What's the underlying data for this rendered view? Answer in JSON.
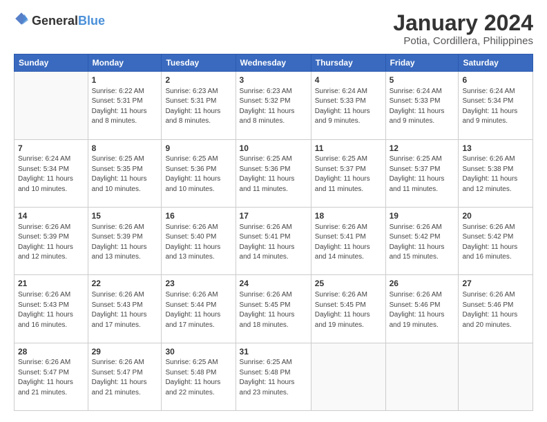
{
  "header": {
    "logo_general": "General",
    "logo_blue": "Blue",
    "month": "January 2024",
    "location": "Potia, Cordillera, Philippines"
  },
  "weekdays": [
    "Sunday",
    "Monday",
    "Tuesday",
    "Wednesday",
    "Thursday",
    "Friday",
    "Saturday"
  ],
  "rows": [
    [
      {
        "day": "",
        "sunrise": "",
        "sunset": "",
        "daylight": ""
      },
      {
        "day": "1",
        "sunrise": "Sunrise: 6:22 AM",
        "sunset": "Sunset: 5:31 PM",
        "daylight": "Daylight: 11 hours and 8 minutes."
      },
      {
        "day": "2",
        "sunrise": "Sunrise: 6:23 AM",
        "sunset": "Sunset: 5:31 PM",
        "daylight": "Daylight: 11 hours and 8 minutes."
      },
      {
        "day": "3",
        "sunrise": "Sunrise: 6:23 AM",
        "sunset": "Sunset: 5:32 PM",
        "daylight": "Daylight: 11 hours and 8 minutes."
      },
      {
        "day": "4",
        "sunrise": "Sunrise: 6:24 AM",
        "sunset": "Sunset: 5:33 PM",
        "daylight": "Daylight: 11 hours and 9 minutes."
      },
      {
        "day": "5",
        "sunrise": "Sunrise: 6:24 AM",
        "sunset": "Sunset: 5:33 PM",
        "daylight": "Daylight: 11 hours and 9 minutes."
      },
      {
        "day": "6",
        "sunrise": "Sunrise: 6:24 AM",
        "sunset": "Sunset: 5:34 PM",
        "daylight": "Daylight: 11 hours and 9 minutes."
      }
    ],
    [
      {
        "day": "7",
        "sunrise": "Sunrise: 6:24 AM",
        "sunset": "Sunset: 5:34 PM",
        "daylight": "Daylight: 11 hours and 10 minutes."
      },
      {
        "day": "8",
        "sunrise": "Sunrise: 6:25 AM",
        "sunset": "Sunset: 5:35 PM",
        "daylight": "Daylight: 11 hours and 10 minutes."
      },
      {
        "day": "9",
        "sunrise": "Sunrise: 6:25 AM",
        "sunset": "Sunset: 5:36 PM",
        "daylight": "Daylight: 11 hours and 10 minutes."
      },
      {
        "day": "10",
        "sunrise": "Sunrise: 6:25 AM",
        "sunset": "Sunset: 5:36 PM",
        "daylight": "Daylight: 11 hours and 11 minutes."
      },
      {
        "day": "11",
        "sunrise": "Sunrise: 6:25 AM",
        "sunset": "Sunset: 5:37 PM",
        "daylight": "Daylight: 11 hours and 11 minutes."
      },
      {
        "day": "12",
        "sunrise": "Sunrise: 6:25 AM",
        "sunset": "Sunset: 5:37 PM",
        "daylight": "Daylight: 11 hours and 11 minutes."
      },
      {
        "day": "13",
        "sunrise": "Sunrise: 6:26 AM",
        "sunset": "Sunset: 5:38 PM",
        "daylight": "Daylight: 11 hours and 12 minutes."
      }
    ],
    [
      {
        "day": "14",
        "sunrise": "Sunrise: 6:26 AM",
        "sunset": "Sunset: 5:39 PM",
        "daylight": "Daylight: 11 hours and 12 minutes."
      },
      {
        "day": "15",
        "sunrise": "Sunrise: 6:26 AM",
        "sunset": "Sunset: 5:39 PM",
        "daylight": "Daylight: 11 hours and 13 minutes."
      },
      {
        "day": "16",
        "sunrise": "Sunrise: 6:26 AM",
        "sunset": "Sunset: 5:40 PM",
        "daylight": "Daylight: 11 hours and 13 minutes."
      },
      {
        "day": "17",
        "sunrise": "Sunrise: 6:26 AM",
        "sunset": "Sunset: 5:41 PM",
        "daylight": "Daylight: 11 hours and 14 minutes."
      },
      {
        "day": "18",
        "sunrise": "Sunrise: 6:26 AM",
        "sunset": "Sunset: 5:41 PM",
        "daylight": "Daylight: 11 hours and 14 minutes."
      },
      {
        "day": "19",
        "sunrise": "Sunrise: 6:26 AM",
        "sunset": "Sunset: 5:42 PM",
        "daylight": "Daylight: 11 hours and 15 minutes."
      },
      {
        "day": "20",
        "sunrise": "Sunrise: 6:26 AM",
        "sunset": "Sunset: 5:42 PM",
        "daylight": "Daylight: 11 hours and 16 minutes."
      }
    ],
    [
      {
        "day": "21",
        "sunrise": "Sunrise: 6:26 AM",
        "sunset": "Sunset: 5:43 PM",
        "daylight": "Daylight: 11 hours and 16 minutes."
      },
      {
        "day": "22",
        "sunrise": "Sunrise: 6:26 AM",
        "sunset": "Sunset: 5:43 PM",
        "daylight": "Daylight: 11 hours and 17 minutes."
      },
      {
        "day": "23",
        "sunrise": "Sunrise: 6:26 AM",
        "sunset": "Sunset: 5:44 PM",
        "daylight": "Daylight: 11 hours and 17 minutes."
      },
      {
        "day": "24",
        "sunrise": "Sunrise: 6:26 AM",
        "sunset": "Sunset: 5:45 PM",
        "daylight": "Daylight: 11 hours and 18 minutes."
      },
      {
        "day": "25",
        "sunrise": "Sunrise: 6:26 AM",
        "sunset": "Sunset: 5:45 PM",
        "daylight": "Daylight: 11 hours and 19 minutes."
      },
      {
        "day": "26",
        "sunrise": "Sunrise: 6:26 AM",
        "sunset": "Sunset: 5:46 PM",
        "daylight": "Daylight: 11 hours and 19 minutes."
      },
      {
        "day": "27",
        "sunrise": "Sunrise: 6:26 AM",
        "sunset": "Sunset: 5:46 PM",
        "daylight": "Daylight: 11 hours and 20 minutes."
      }
    ],
    [
      {
        "day": "28",
        "sunrise": "Sunrise: 6:26 AM",
        "sunset": "Sunset: 5:47 PM",
        "daylight": "Daylight: 11 hours and 21 minutes."
      },
      {
        "day": "29",
        "sunrise": "Sunrise: 6:26 AM",
        "sunset": "Sunset: 5:47 PM",
        "daylight": "Daylight: 11 hours and 21 minutes."
      },
      {
        "day": "30",
        "sunrise": "Sunrise: 6:25 AM",
        "sunset": "Sunset: 5:48 PM",
        "daylight": "Daylight: 11 hours and 22 minutes."
      },
      {
        "day": "31",
        "sunrise": "Sunrise: 6:25 AM",
        "sunset": "Sunset: 5:48 PM",
        "daylight": "Daylight: 11 hours and 23 minutes."
      },
      {
        "day": "",
        "sunrise": "",
        "sunset": "",
        "daylight": ""
      },
      {
        "day": "",
        "sunrise": "",
        "sunset": "",
        "daylight": ""
      },
      {
        "day": "",
        "sunrise": "",
        "sunset": "",
        "daylight": ""
      }
    ]
  ]
}
